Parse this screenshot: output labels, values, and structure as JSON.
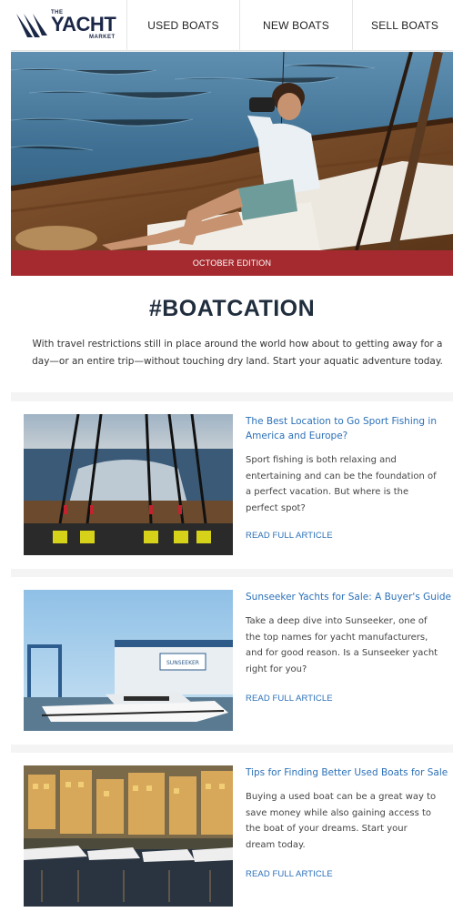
{
  "nav": {
    "logo": {
      "the": "THE",
      "yacht": "YACHT",
      "market": "MARKET",
      "reg": "®"
    },
    "items": [
      {
        "label": "USED BOATS"
      },
      {
        "label": "NEW BOATS"
      },
      {
        "label": "SELL BOATS"
      }
    ]
  },
  "hero": {
    "edition": "OCTOBER EDITION"
  },
  "intro": {
    "headline": "#BOATCATION",
    "line1": "With travel restrictions still in place around the world how about to getting away for a",
    "line2": "day—or an entire trip—without touching dry land. Start your aquatic adventure today."
  },
  "articles": [
    {
      "title_line1": "The Best Location to Go Sport Fishing in",
      "title_line2": "America and Europe?",
      "body": [
        "Sport fishing is both relaxing and",
        "entertaining and can be the foundation of",
        "a perfect vacation. But where is the",
        "perfect spot?"
      ],
      "link": "READ FULL ARTICLE"
    },
    {
      "title_line1": "Sunseeker Yachts for Sale: A Buyer's Guide",
      "body": [
        "Take a deep dive into Sunseeker, one of",
        "the top names for yacht manufacturers,",
        "and for good reason. Is a Sunseeker yacht",
        "right for you?"
      ],
      "link": "READ FULL ARTICLE",
      "sign_text": "SUNSEEKER"
    },
    {
      "title_line1": "Tips for Finding Better Used Boats for Sale",
      "body": [
        "Buying a used boat can be a great way to",
        "save money while also gaining access to",
        "the boat of your dreams. Start your",
        "dream today."
      ],
      "link": "READ FULL ARTICLE"
    }
  ]
}
